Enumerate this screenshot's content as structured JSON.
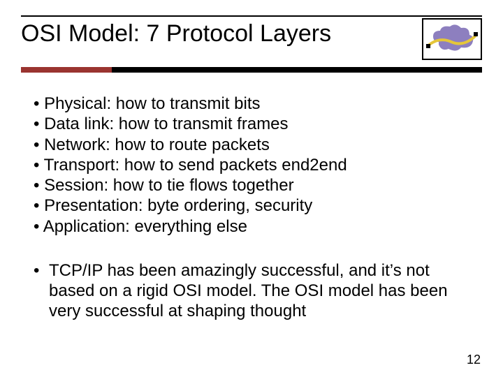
{
  "title": "OSI Model: 7 Protocol Layers",
  "layers": [
    "Physical:  how to transmit bits",
    "Data link: how to transmit frames",
    "Network: how to route packets",
    "Transport: how to send packets end2end",
    "Session: how to tie flows together",
    "Presentation: byte ordering, security",
    "Application: everything else"
  ],
  "note": "TCP/IP has been amazingly successful, and it’s not based on a rigid OSI model. The OSI model has been very successful at shaping thought",
  "page_number": "12",
  "colors": {
    "accent": "#9a3430",
    "cloud": "#8d7fbf",
    "cable": "#e5c63a"
  }
}
